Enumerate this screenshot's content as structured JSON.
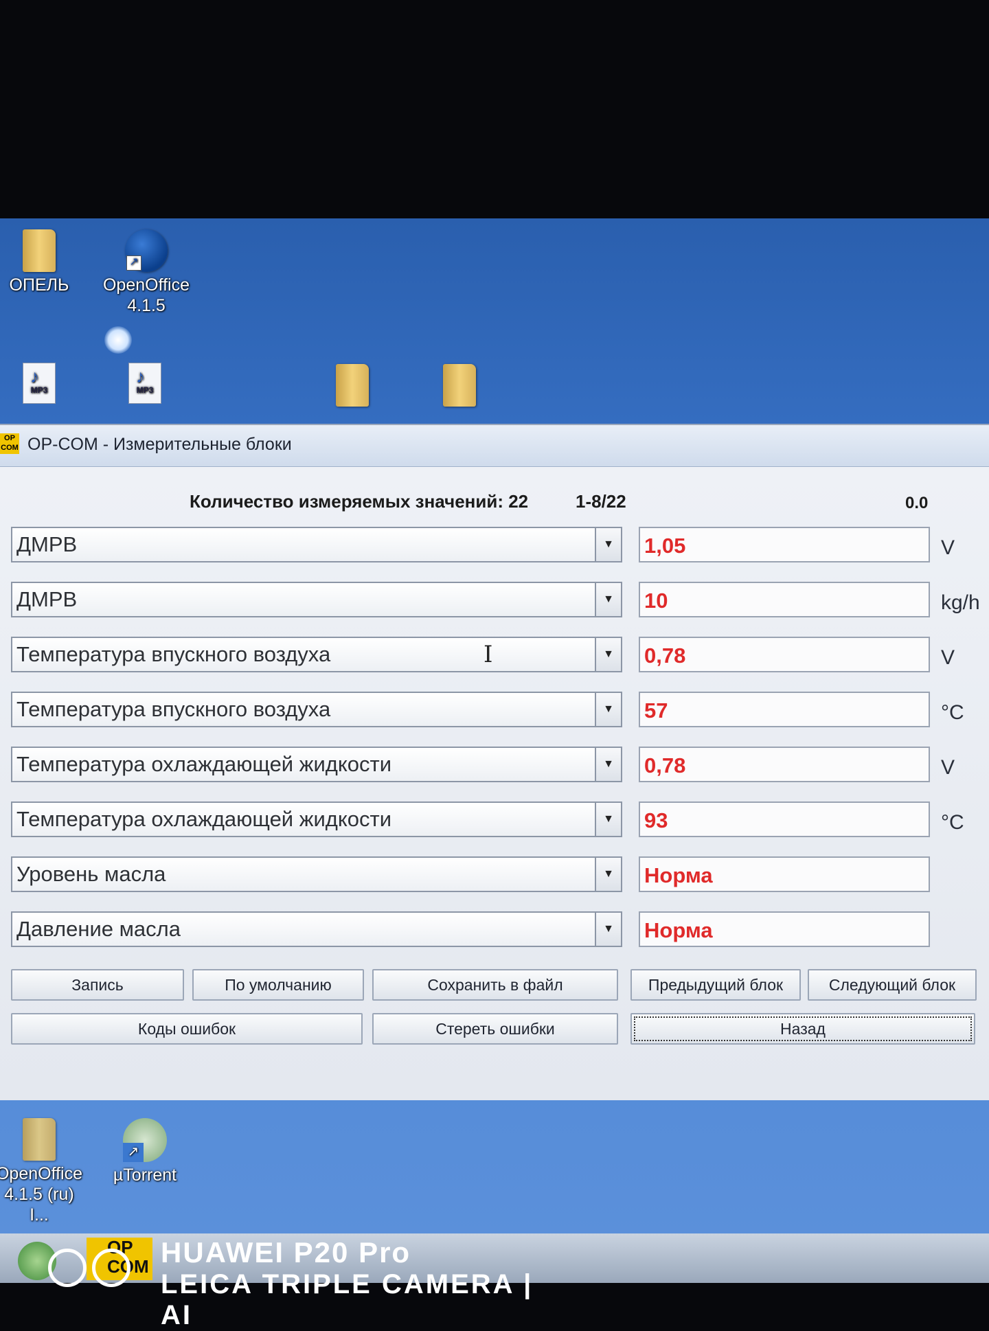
{
  "desktop": {
    "icons_top": [
      {
        "label": "ОПЕЛЬ",
        "icon": "folder-icon"
      },
      {
        "label": "OpenOffice 4.1.5",
        "icon": "openoffice-icon"
      }
    ],
    "icons_mid": [
      {
        "label": "MP3",
        "icon": "mp3-file-icon"
      },
      {
        "label": "MP3",
        "icon": "mp3-file-icon"
      }
    ],
    "icons_bottom": [
      {
        "label": "OpenOffice 4.1.5 (ru) I...",
        "icon": "folder-icon"
      },
      {
        "label": "µTorrent",
        "icon": "utorrent-icon"
      }
    ]
  },
  "window": {
    "app_icon_text": "OP COM",
    "title": "OP-COM - Измерительные блоки",
    "count_label": "Количество измеряемых значений: 22",
    "range_label": "1-8/22",
    "timer": "0.0",
    "rows": [
      {
        "name": "ДМРВ",
        "value": "1,05",
        "unit": "V"
      },
      {
        "name": "ДМРВ",
        "value": "10",
        "unit": "kg/h"
      },
      {
        "name": "Температура впускного воздуха",
        "value": "0,78",
        "unit": "V"
      },
      {
        "name": "Температура впускного воздуха",
        "value": "57",
        "unit": "°C"
      },
      {
        "name": "Температура охлаждающей жидкости",
        "value": "0,78",
        "unit": "V"
      },
      {
        "name": "Температура охлаждающей жидкости",
        "value": "93",
        "unit": "°C"
      },
      {
        "name": "Уровень масла",
        "value": "Норма",
        "unit": ""
      },
      {
        "name": "Давление масла",
        "value": "Норма",
        "unit": ""
      }
    ],
    "buttons": {
      "record": "Запись",
      "default": "По умолчанию",
      "save_file": "Сохранить в файл",
      "prev_block": "Предыдущий блок",
      "next_block": "Следующий блок",
      "error_codes": "Коды ошибок",
      "clear_errors": "Стереть ошибки",
      "back": "Назад"
    }
  },
  "taskbar": {
    "app_label": "OP COM"
  },
  "watermark": {
    "line1": "HUAWEI P20 Pro",
    "line2": "LEICA TRIPLE CAMERA | AI"
  },
  "colors": {
    "value_text": "#e02a2a",
    "desktop": "#3a74c9"
  }
}
